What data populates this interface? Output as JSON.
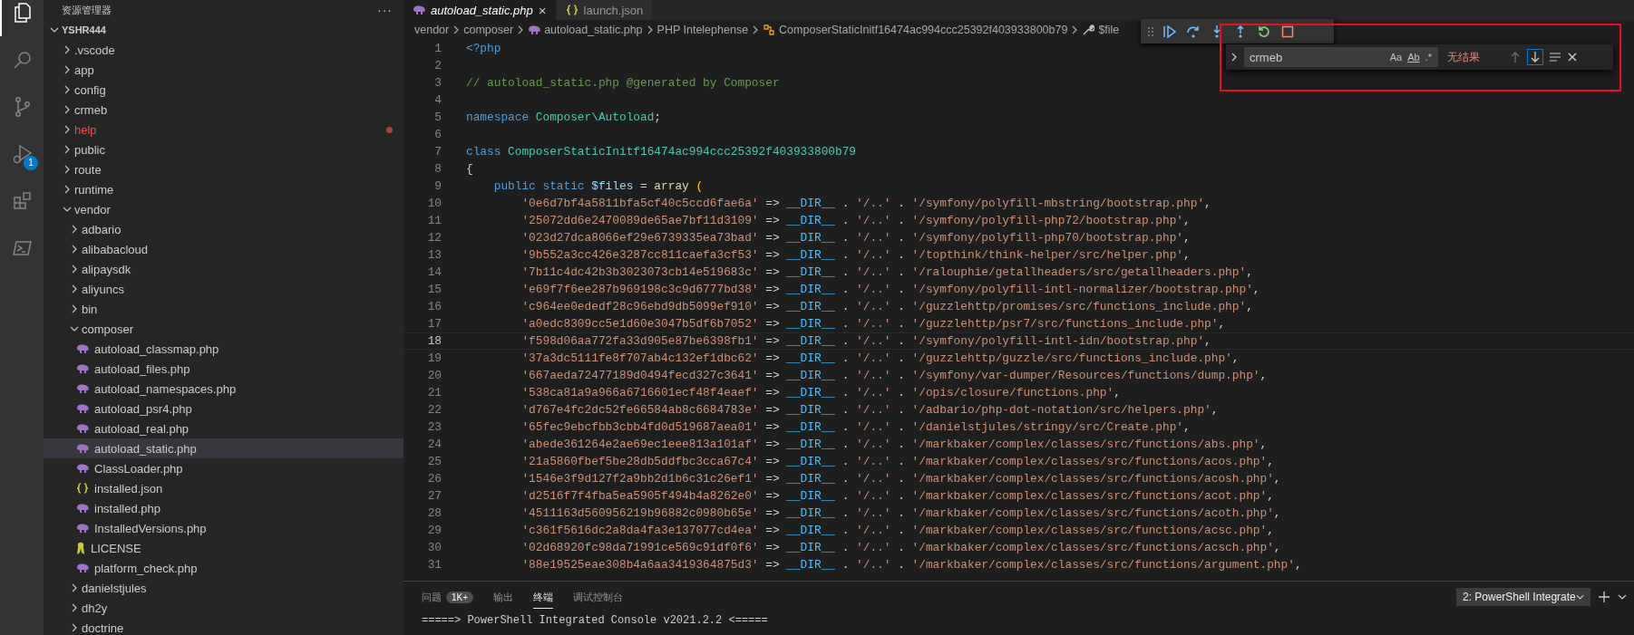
{
  "activity_bar": [
    {
      "kind": "explorer",
      "selected": true
    },
    {
      "kind": "search",
      "selected": false
    },
    {
      "kind": "source-control",
      "selected": false
    },
    {
      "kind": "debug",
      "selected": false,
      "badge": "1"
    },
    {
      "kind": "extensions",
      "selected": false
    },
    {
      "kind": "terminal",
      "selected": false
    }
  ],
  "sidebar": {
    "title": "资源管理器",
    "more": "···",
    "tree": {
      "name": "YSHR444",
      "kind": "root",
      "expanded": true,
      "selected": false,
      "problem": false,
      "children": [
        {
          "name": ".vscode",
          "kind": "folder",
          "expanded": false,
          "selected": false,
          "problem": false
        },
        {
          "name": "app",
          "kind": "folder",
          "expanded": false,
          "selected": false,
          "problem": false
        },
        {
          "name": "config",
          "kind": "folder",
          "expanded": false,
          "selected": false,
          "problem": false
        },
        {
          "name": "crmeb",
          "kind": "folder",
          "expanded": false,
          "selected": false,
          "problem": false
        },
        {
          "name": "help",
          "kind": "folder",
          "expanded": false,
          "selected": false,
          "problem": true
        },
        {
          "name": "public",
          "kind": "folder",
          "expanded": false,
          "selected": false,
          "problem": false
        },
        {
          "name": "route",
          "kind": "folder",
          "expanded": false,
          "selected": false,
          "problem": false
        },
        {
          "name": "runtime",
          "kind": "folder",
          "expanded": false,
          "selected": false,
          "problem": false
        },
        {
          "name": "vendor",
          "kind": "folder",
          "expanded": true,
          "selected": false,
          "problem": false,
          "children": [
            {
              "name": "adbario",
              "kind": "folder",
              "expanded": false,
              "selected": false,
              "problem": false
            },
            {
              "name": "alibabacloud",
              "kind": "folder",
              "expanded": false,
              "selected": false,
              "problem": false
            },
            {
              "name": "alipaysdk",
              "kind": "folder",
              "expanded": false,
              "selected": false,
              "problem": false
            },
            {
              "name": "aliyuncs",
              "kind": "folder",
              "expanded": false,
              "selected": false,
              "problem": false
            },
            {
              "name": "bin",
              "kind": "folder",
              "expanded": false,
              "selected": false,
              "problem": false
            },
            {
              "name": "composer",
              "kind": "folder",
              "expanded": true,
              "selected": false,
              "problem": false,
              "children": [
                {
                  "name": "autoload_classmap.php",
                  "kind": "php",
                  "selected": false,
                  "problem": false
                },
                {
                  "name": "autoload_files.php",
                  "kind": "php",
                  "selected": false,
                  "problem": false
                },
                {
                  "name": "autoload_namespaces.php",
                  "kind": "php",
                  "selected": false,
                  "problem": false
                },
                {
                  "name": "autoload_psr4.php",
                  "kind": "php",
                  "selected": false,
                  "problem": false
                },
                {
                  "name": "autoload_real.php",
                  "kind": "php",
                  "selected": false,
                  "problem": false
                },
                {
                  "name": "autoload_static.php",
                  "kind": "php",
                  "selected": true,
                  "problem": false
                },
                {
                  "name": "ClassLoader.php",
                  "kind": "php",
                  "selected": false,
                  "problem": false
                },
                {
                  "name": "installed.json",
                  "kind": "json",
                  "selected": false,
                  "problem": false
                },
                {
                  "name": "installed.php",
                  "kind": "php",
                  "selected": false,
                  "problem": false
                },
                {
                  "name": "InstalledVersions.php",
                  "kind": "php",
                  "selected": false,
                  "problem": false
                },
                {
                  "name": "LICENSE",
                  "kind": "license",
                  "selected": false,
                  "problem": false
                },
                {
                  "name": "platform_check.php",
                  "kind": "php",
                  "selected": false,
                  "problem": false
                }
              ]
            },
            {
              "name": "danielstjules",
              "kind": "folder",
              "expanded": false,
              "selected": false,
              "problem": false
            },
            {
              "name": "dh2y",
              "kind": "folder",
              "expanded": false,
              "selected": false,
              "problem": false
            },
            {
              "name": "doctrine",
              "kind": "folder",
              "expanded": false,
              "selected": false,
              "problem": false
            }
          ]
        }
      ]
    }
  },
  "tabs": [
    {
      "label": "autoload_static.php",
      "kind": "php",
      "selected": true,
      "close": "×"
    },
    {
      "label": "launch.json",
      "kind": "json",
      "selected": false
    }
  ],
  "breadcrumb": [
    {
      "text": "vendor",
      "kind": "plain"
    },
    {
      "text": "composer",
      "kind": "plain"
    },
    {
      "text": "autoload_static.php",
      "kind": "php"
    },
    {
      "text": "PHP Intelephense",
      "kind": "plain"
    },
    {
      "text": "ComposerStaticInitf16474ac994ccc25392f403933800b79",
      "kind": "class"
    },
    {
      "text": "$file",
      "kind": "field"
    }
  ],
  "find_widget": {
    "value": "crmeb",
    "toggles": [
      {
        "label": "Aa",
        "on": false
      },
      {
        "label": "Ab",
        "on": false
      },
      {
        "label": ".*",
        "on": false
      }
    ],
    "status": "无结果"
  },
  "code": [
    {
      "n": "1",
      "current": false,
      "tokens": [
        {
          "kind": "keyword",
          "text": "<?php"
        }
      ]
    },
    {
      "n": "2",
      "current": false
    },
    {
      "n": "3",
      "current": false,
      "tokens": [
        {
          "kind": "comment",
          "text": "// autoload_static.php @generated by Composer"
        }
      ]
    },
    {
      "n": "4",
      "current": false
    },
    {
      "n": "5",
      "current": false,
      "tokens": [
        {
          "kind": "keyword",
          "text": "namespace "
        },
        {
          "kind": "type",
          "text": "Composer\\Autoload"
        },
        {
          "kind": "plain",
          "text": ";"
        }
      ]
    },
    {
      "n": "6",
      "current": false
    },
    {
      "n": "7",
      "current": false,
      "tokens": [
        {
          "kind": "keyword",
          "text": "class "
        },
        {
          "kind": "type",
          "text": "ComposerStaticInitf16474ac994ccc25392f403933800b79"
        }
      ]
    },
    {
      "n": "8",
      "current": false,
      "tokens": [
        {
          "kind": "plain",
          "text": "{"
        }
      ]
    },
    {
      "n": "9",
      "current": false,
      "tokens": [
        {
          "kind": "keyword",
          "text": "    public static "
        },
        {
          "kind": "variable",
          "text": "$files "
        },
        {
          "kind": "plain",
          "text": "= "
        },
        {
          "kind": "function",
          "text": "array "
        },
        {
          "kind": "bracket",
          "text": "("
        }
      ]
    },
    {
      "n": "10",
      "current": false,
      "tokens": [
        {
          "kind": "string",
          "text": "        '0e6d7bf4a5811bfa5cf40c5ccd6fae6a'"
        },
        {
          "kind": "plain",
          "text": " => "
        },
        {
          "kind": "constant",
          "text": "__DIR__"
        },
        {
          "kind": "plain",
          "text": " . "
        },
        {
          "kind": "string",
          "text": "'/..'"
        },
        {
          "kind": "plain",
          "text": " . "
        },
        {
          "kind": "string",
          "text": "'/symfony/polyfill-mbstring/bootstrap.php'"
        },
        {
          "kind": "plain",
          "text": ","
        }
      ]
    },
    {
      "n": "11",
      "current": false,
      "tokens": [
        {
          "kind": "string",
          "text": "        '25072dd6e2470089de65ae7bf11d3109'"
        },
        {
          "kind": "plain",
          "text": " => "
        },
        {
          "kind": "constant",
          "text": "__DIR__"
        },
        {
          "kind": "plain",
          "text": " . "
        },
        {
          "kind": "string",
          "text": "'/..'"
        },
        {
          "kind": "plain",
          "text": " . "
        },
        {
          "kind": "string",
          "text": "'/symfony/polyfill-php72/bootstrap.php'"
        },
        {
          "kind": "plain",
          "text": ","
        }
      ]
    },
    {
      "n": "12",
      "current": false,
      "tokens": [
        {
          "kind": "string",
          "text": "        '023d27dca8066ef29e6739335ea73bad'"
        },
        {
          "kind": "plain",
          "text": " => "
        },
        {
          "kind": "constant",
          "text": "__DIR__"
        },
        {
          "kind": "plain",
          "text": " . "
        },
        {
          "kind": "string",
          "text": "'/..'"
        },
        {
          "kind": "plain",
          "text": " . "
        },
        {
          "kind": "string",
          "text": "'/symfony/polyfill-php70/bootstrap.php'"
        },
        {
          "kind": "plain",
          "text": ","
        }
      ]
    },
    {
      "n": "13",
      "current": false,
      "tokens": [
        {
          "kind": "string",
          "text": "        '9b552a3cc426e3287cc811caefa3cf53'"
        },
        {
          "kind": "plain",
          "text": " => "
        },
        {
          "kind": "constant",
          "text": "__DIR__"
        },
        {
          "kind": "plain",
          "text": " . "
        },
        {
          "kind": "string",
          "text": "'/..'"
        },
        {
          "kind": "plain",
          "text": " . "
        },
        {
          "kind": "string",
          "text": "'/topthink/think-helper/src/helper.php'"
        },
        {
          "kind": "plain",
          "text": ","
        }
      ]
    },
    {
      "n": "14",
      "current": false,
      "tokens": [
        {
          "kind": "string",
          "text": "        '7b11c4dc42b3b3023073cb14e519683c'"
        },
        {
          "kind": "plain",
          "text": " => "
        },
        {
          "kind": "constant",
          "text": "__DIR__"
        },
        {
          "kind": "plain",
          "text": " . "
        },
        {
          "kind": "string",
          "text": "'/..'"
        },
        {
          "kind": "plain",
          "text": " . "
        },
        {
          "kind": "string",
          "text": "'/ralouphie/getallheaders/src/getallheaders.php'"
        },
        {
          "kind": "plain",
          "text": ","
        }
      ]
    },
    {
      "n": "15",
      "current": false,
      "tokens": [
        {
          "kind": "string",
          "text": "        'e69f7f6ee287b969198c3c9d6777bd38'"
        },
        {
          "kind": "plain",
          "text": " => "
        },
        {
          "kind": "constant",
          "text": "__DIR__"
        },
        {
          "kind": "plain",
          "text": " . "
        },
        {
          "kind": "string",
          "text": "'/..'"
        },
        {
          "kind": "plain",
          "text": " . "
        },
        {
          "kind": "string",
          "text": "'/symfony/polyfill-intl-normalizer/bootstrap.php'"
        },
        {
          "kind": "plain",
          "text": ","
        }
      ]
    },
    {
      "n": "16",
      "current": false,
      "tokens": [
        {
          "kind": "string",
          "text": "        'c964ee0ededf28c96ebd9db5099ef910'"
        },
        {
          "kind": "plain",
          "text": " => "
        },
        {
          "kind": "constant",
          "text": "__DIR__"
        },
        {
          "kind": "plain",
          "text": " . "
        },
        {
          "kind": "string",
          "text": "'/..'"
        },
        {
          "kind": "plain",
          "text": " . "
        },
        {
          "kind": "string",
          "text": "'/guzzlehttp/promises/src/functions_include.php'"
        },
        {
          "kind": "plain",
          "text": ","
        }
      ]
    },
    {
      "n": "17",
      "current": false,
      "tokens": [
        {
          "kind": "string",
          "text": "        'a0edc8309cc5e1d60e3047b5df6b7052'"
        },
        {
          "kind": "plain",
          "text": " => "
        },
        {
          "kind": "constant",
          "text": "__DIR__"
        },
        {
          "kind": "plain",
          "text": " . "
        },
        {
          "kind": "string",
          "text": "'/..'"
        },
        {
          "kind": "plain",
          "text": " . "
        },
        {
          "kind": "string",
          "text": "'/guzzlehttp/psr7/src/functions_include.php'"
        },
        {
          "kind": "plain",
          "text": ","
        }
      ]
    },
    {
      "n": "18",
      "current": true,
      "tokens": [
        {
          "kind": "string",
          "text": "        'f598d06aa772fa33d905e87be6398fb1'"
        },
        {
          "kind": "plain",
          "text": " => "
        },
        {
          "kind": "constant",
          "text": "__DIR__"
        },
        {
          "kind": "plain",
          "text": " . "
        },
        {
          "kind": "string",
          "text": "'/..'"
        },
        {
          "kind": "plain",
          "text": " . "
        },
        {
          "kind": "string",
          "text": "'/symfony/polyfill-intl-idn/bootstrap.php'"
        },
        {
          "kind": "plain",
          "text": ","
        }
      ]
    },
    {
      "n": "19",
      "current": false,
      "tokens": [
        {
          "kind": "string",
          "text": "        '37a3dc5111fe8f707ab4c132ef1dbc62'"
        },
        {
          "kind": "plain",
          "text": " => "
        },
        {
          "kind": "constant",
          "text": "__DIR__"
        },
        {
          "kind": "plain",
          "text": " . "
        },
        {
          "kind": "string",
          "text": "'/..'"
        },
        {
          "kind": "plain",
          "text": " . "
        },
        {
          "kind": "string",
          "text": "'/guzzlehttp/guzzle/src/functions_include.php'"
        },
        {
          "kind": "plain",
          "text": ","
        }
      ]
    },
    {
      "n": "20",
      "current": false,
      "tokens": [
        {
          "kind": "string",
          "text": "        '667aeda72477189d0494fecd327c3641'"
        },
        {
          "kind": "plain",
          "text": " => "
        },
        {
          "kind": "constant",
          "text": "__DIR__"
        },
        {
          "kind": "plain",
          "text": " . "
        },
        {
          "kind": "string",
          "text": "'/..'"
        },
        {
          "kind": "plain",
          "text": " . "
        },
        {
          "kind": "string",
          "text": "'/symfony/var-dumper/Resources/functions/dump.php'"
        },
        {
          "kind": "plain",
          "text": ","
        }
      ]
    },
    {
      "n": "21",
      "current": false,
      "tokens": [
        {
          "kind": "string",
          "text": "        '538ca81a9a966a6716601ecf48f4eaef'"
        },
        {
          "kind": "plain",
          "text": " => "
        },
        {
          "kind": "constant",
          "text": "__DIR__"
        },
        {
          "kind": "plain",
          "text": " . "
        },
        {
          "kind": "string",
          "text": "'/..'"
        },
        {
          "kind": "plain",
          "text": " . "
        },
        {
          "kind": "string",
          "text": "'/opis/closure/functions.php'"
        },
        {
          "kind": "plain",
          "text": ","
        }
      ]
    },
    {
      "n": "22",
      "current": false,
      "tokens": [
        {
          "kind": "string",
          "text": "        'd767e4fc2dc52fe66584ab8c6684783e'"
        },
        {
          "kind": "plain",
          "text": " => "
        },
        {
          "kind": "constant",
          "text": "__DIR__"
        },
        {
          "kind": "plain",
          "text": " . "
        },
        {
          "kind": "string",
          "text": "'/..'"
        },
        {
          "kind": "plain",
          "text": " . "
        },
        {
          "kind": "string",
          "text": "'/adbario/php-dot-notation/src/helpers.php'"
        },
        {
          "kind": "plain",
          "text": ","
        }
      ]
    },
    {
      "n": "23",
      "current": false,
      "tokens": [
        {
          "kind": "string",
          "text": "        '65fec9ebcfbb3cbb4fd0d519687aea01'"
        },
        {
          "kind": "plain",
          "text": " => "
        },
        {
          "kind": "constant",
          "text": "__DIR__"
        },
        {
          "kind": "plain",
          "text": " . "
        },
        {
          "kind": "string",
          "text": "'/..'"
        },
        {
          "kind": "plain",
          "text": " . "
        },
        {
          "kind": "string",
          "text": "'/danielstjules/stringy/src/Create.php'"
        },
        {
          "kind": "plain",
          "text": ","
        }
      ]
    },
    {
      "n": "24",
      "current": false,
      "tokens": [
        {
          "kind": "string",
          "text": "        'abede361264e2ae69ec1eee813a101af'"
        },
        {
          "kind": "plain",
          "text": " => "
        },
        {
          "kind": "constant",
          "text": "__DIR__"
        },
        {
          "kind": "plain",
          "text": " . "
        },
        {
          "kind": "string",
          "text": "'/..'"
        },
        {
          "kind": "plain",
          "text": " . "
        },
        {
          "kind": "string",
          "text": "'/markbaker/complex/classes/src/functions/abs.php'"
        },
        {
          "kind": "plain",
          "text": ","
        }
      ]
    },
    {
      "n": "25",
      "current": false,
      "tokens": [
        {
          "kind": "string",
          "text": "        '21a5860fbef5be28db5ddfbc3cca67c4'"
        },
        {
          "kind": "plain",
          "text": " => "
        },
        {
          "kind": "constant",
          "text": "__DIR__"
        },
        {
          "kind": "plain",
          "text": " . "
        },
        {
          "kind": "string",
          "text": "'/..'"
        },
        {
          "kind": "plain",
          "text": " . "
        },
        {
          "kind": "string",
          "text": "'/markbaker/complex/classes/src/functions/acos.php'"
        },
        {
          "kind": "plain",
          "text": ","
        }
      ]
    },
    {
      "n": "26",
      "current": false,
      "tokens": [
        {
          "kind": "string",
          "text": "        '1546e3f9d127f2a9bb2d1b6c31c26ef1'"
        },
        {
          "kind": "plain",
          "text": " => "
        },
        {
          "kind": "constant",
          "text": "__DIR__"
        },
        {
          "kind": "plain",
          "text": " . "
        },
        {
          "kind": "string",
          "text": "'/..'"
        },
        {
          "kind": "plain",
          "text": " . "
        },
        {
          "kind": "string",
          "text": "'/markbaker/complex/classes/src/functions/acosh.php'"
        },
        {
          "kind": "plain",
          "text": ","
        }
      ]
    },
    {
      "n": "27",
      "current": false,
      "tokens": [
        {
          "kind": "string",
          "text": "        'd2516f7f4fba5ea5905f494b4a8262e0'"
        },
        {
          "kind": "plain",
          "text": " => "
        },
        {
          "kind": "constant",
          "text": "__DIR__"
        },
        {
          "kind": "plain",
          "text": " . "
        },
        {
          "kind": "string",
          "text": "'/..'"
        },
        {
          "kind": "plain",
          "text": " . "
        },
        {
          "kind": "string",
          "text": "'/markbaker/complex/classes/src/functions/acot.php'"
        },
        {
          "kind": "plain",
          "text": ","
        }
      ]
    },
    {
      "n": "28",
      "current": false,
      "tokens": [
        {
          "kind": "string",
          "text": "        '4511163d560956219b96882c0980b65e'"
        },
        {
          "kind": "plain",
          "text": " => "
        },
        {
          "kind": "constant",
          "text": "__DIR__"
        },
        {
          "kind": "plain",
          "text": " . "
        },
        {
          "kind": "string",
          "text": "'/..'"
        },
        {
          "kind": "plain",
          "text": " . "
        },
        {
          "kind": "string",
          "text": "'/markbaker/complex/classes/src/functions/acoth.php'"
        },
        {
          "kind": "plain",
          "text": ","
        }
      ]
    },
    {
      "n": "29",
      "current": false,
      "tokens": [
        {
          "kind": "string",
          "text": "        'c361f5616dc2a8da4fa3e137077cd4ea'"
        },
        {
          "kind": "plain",
          "text": " => "
        },
        {
          "kind": "constant",
          "text": "__DIR__"
        },
        {
          "kind": "plain",
          "text": " . "
        },
        {
          "kind": "string",
          "text": "'/..'"
        },
        {
          "kind": "plain",
          "text": " . "
        },
        {
          "kind": "string",
          "text": "'/markbaker/complex/classes/src/functions/acsc.php'"
        },
        {
          "kind": "plain",
          "text": ","
        }
      ]
    },
    {
      "n": "30",
      "current": false,
      "tokens": [
        {
          "kind": "string",
          "text": "        '02d68920fc98da71991ce569c91df0f6'"
        },
        {
          "kind": "plain",
          "text": " => "
        },
        {
          "kind": "constant",
          "text": "__DIR__"
        },
        {
          "kind": "plain",
          "text": " . "
        },
        {
          "kind": "string",
          "text": "'/..'"
        },
        {
          "kind": "plain",
          "text": " . "
        },
        {
          "kind": "string",
          "text": "'/markbaker/complex/classes/src/functions/acsch.php'"
        },
        {
          "kind": "plain",
          "text": ","
        }
      ]
    },
    {
      "n": "31",
      "current": false,
      "tokens": [
        {
          "kind": "string",
          "text": "        '88e19525eae308b4a6aa3419364875d3'"
        },
        {
          "kind": "plain",
          "text": " => "
        },
        {
          "kind": "constant",
          "text": "__DIR__"
        },
        {
          "kind": "plain",
          "text": " . "
        },
        {
          "kind": "string",
          "text": "'/..'"
        },
        {
          "kind": "plain",
          "text": " . "
        },
        {
          "kind": "string",
          "text": "'/markbaker/complex/classes/src/functions/argument.php'"
        },
        {
          "kind": "plain",
          "text": ","
        }
      ]
    }
  ],
  "panel": {
    "tabs": [
      {
        "label": "问题",
        "badge": "1K+",
        "selected": false
      },
      {
        "label": "输出",
        "selected": false
      },
      {
        "label": "终端",
        "selected": true
      },
      {
        "label": "调试控制台",
        "selected": false
      }
    ],
    "terminal_select": "2: PowerShell Integrate",
    "terminal_lines": [
      "=====> PowerShell Integrated Console v2021.2.2 <====="
    ]
  }
}
